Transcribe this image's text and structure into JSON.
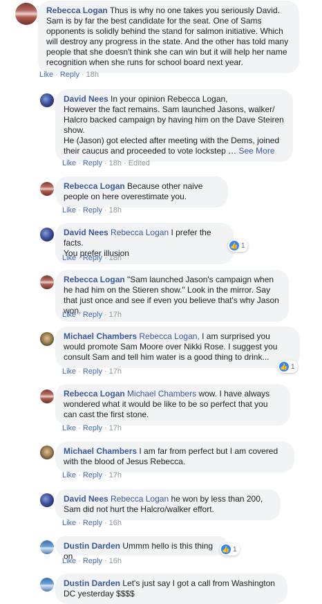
{
  "action_labels": {
    "like": "Like",
    "reply": "Reply",
    "dot": "·"
  },
  "comments": [
    {
      "author": "Rebecca Logan",
      "mention": "",
      "text": "Thus is why no one takes you seriously David. Sam is by far the best candidate for the seat. One of Sams opponents is solidly behind the stand for salmon initiative. Which will destroy any progress in the state. And the other has told many people that she doesn't think she can win but it will help her name recognition when she runs for school board next year.",
      "time": "18h"
    },
    {
      "author": "David Nees",
      "mention": "",
      "text": "In your opinion Rebecca Logan,\nHowever the fact remains. Sam launched Jasons, walker/ Halcro backed campaign by having him on the Dave Steiren show.\nHe (Jason) got elected after meeting with the Dems, joined their caucus and proceeded to vote lockstep …",
      "see_more": "See More",
      "time": "18h",
      "edited": "Edited"
    },
    {
      "author": "Rebecca Logan",
      "mention": "",
      "text": "Because other naive people on here overestimate you.",
      "time": "18h"
    },
    {
      "author": "David Nees",
      "mention": "Rebecca Logan",
      "text": "I prefer the facts.\nYou prefer illusion",
      "time": "18h",
      "reactions": "1"
    },
    {
      "author": "Rebecca Logan",
      "mention": "",
      "text": "\"Sam launched Jason's campaign when he had him on the Stieren show.\" Look in the mirror. Say that just once and see if even you believe that's why Jason won.",
      "time": "17h"
    },
    {
      "author": "Michael Chambers",
      "mention": "Rebecca Logan,",
      "text": "I am surprised you would promote Sam Moore over Nikki Rose. I suggest you consult Sam and tell him water is a good thing to drink...",
      "time": "17h",
      "reactions": "1"
    },
    {
      "author": "Rebecca Logan",
      "mention": "Michael Chambers",
      "text": "wow. I have always wondered what it would be like to be so perfect that you can cast the first stone.",
      "time": "17h"
    },
    {
      "author": "Michael Chambers",
      "mention": "",
      "text": "I am far from perfect but I am covered with the blood of Jesus Rebecca.",
      "time": "17h"
    },
    {
      "author": "David Nees",
      "mention": "Rebecca Logan",
      "text": "he won by less than 200, Sam did not hurt the Halcro/walker effort.",
      "time": "16h"
    },
    {
      "author": "Dustin Darden",
      "mention": "",
      "text": "Ummm hello is this thing on",
      "time": "16h",
      "reactions": "1"
    },
    {
      "author": "Dustin Darden",
      "mention": "",
      "text": "Let's just say I got a call from Washington DC yesterday $$$$",
      "time": ""
    }
  ]
}
